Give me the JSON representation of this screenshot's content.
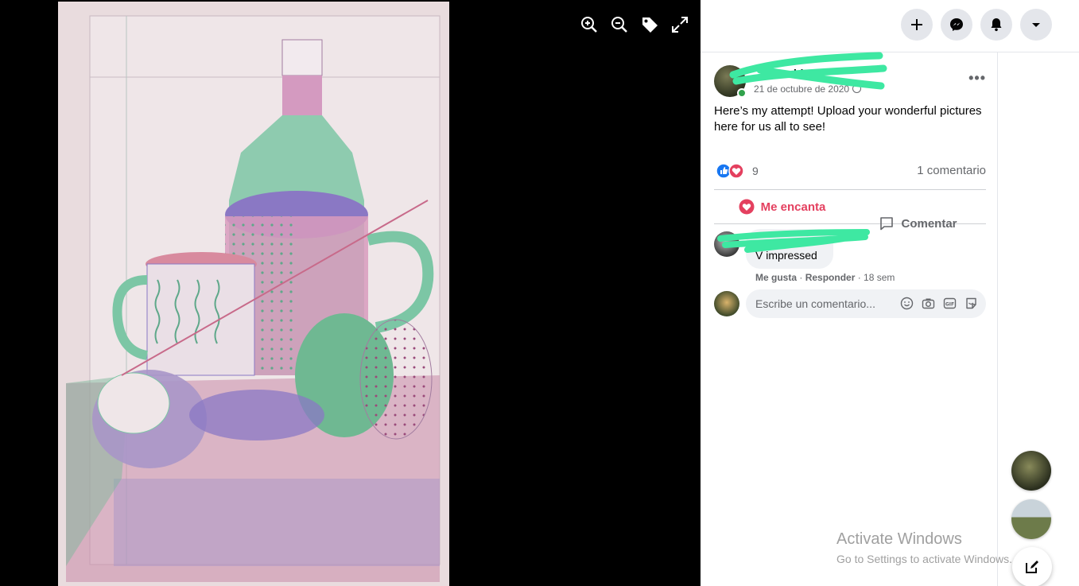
{
  "viewer": {
    "photo_alt": "Colored pencil still-life drawing of a bottle, mugs and fruit",
    "tools": [
      "zoom-in-icon",
      "zoom-out-icon",
      "tag-icon",
      "fullscreen-icon"
    ]
  },
  "topbar": {
    "buttons": [
      "plus-icon",
      "messenger-icon",
      "bell-icon",
      "caret-down-icon"
    ]
  },
  "post": {
    "author_name": "ldwell",
    "date": "21 de octubre de 2020",
    "text": "Here’s my attempt! Upload your wonderful pictures here for us all to see!",
    "reaction_count": "9",
    "comment_count": "1 comentario",
    "actions": {
      "love": "Me encanta",
      "comment": "Comentar"
    }
  },
  "comment": {
    "text": "V impressed",
    "like": "Me gusta",
    "reply": "Responder",
    "time": "18 sem"
  },
  "composer": {
    "placeholder": "Escribe un comentario..."
  },
  "watermark": {
    "title": "Activate Windows",
    "subtitle": "Go to Settings to activate Windows."
  },
  "colors": {
    "love": "#e4405f",
    "like": "#1877f2",
    "online": "#31a24c",
    "redaction": "#3ee8a2"
  }
}
